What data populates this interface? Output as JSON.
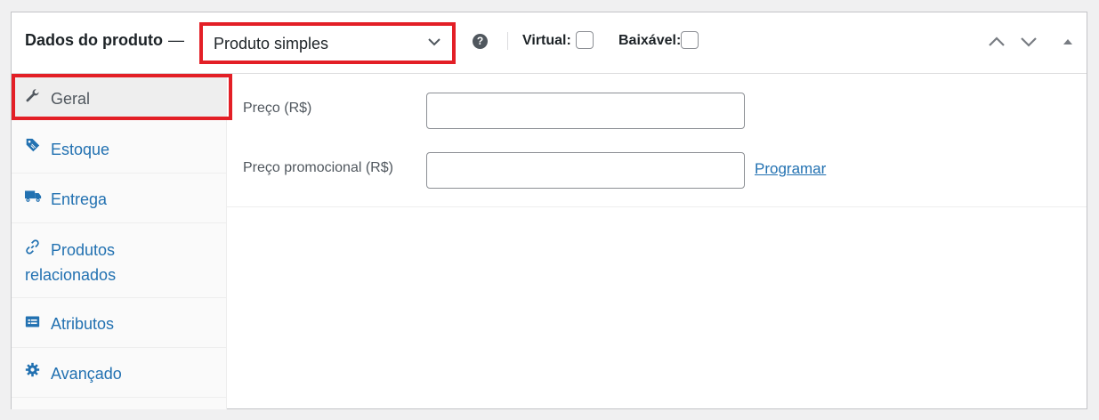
{
  "header": {
    "title": "Dados do produto",
    "title_separator": "—",
    "product_type": {
      "selected": "Produto simples"
    },
    "help_icon": "question-circle-icon",
    "virtual_label": "Virtual:",
    "virtual_checked": false,
    "downloadable_label": "Baixável:",
    "downloadable_checked": false
  },
  "sidebar": {
    "items": [
      {
        "label": "Geral",
        "icon": "wrench-icon",
        "active": true
      },
      {
        "label": "Estoque",
        "icon": "tag-icon",
        "active": false
      },
      {
        "label": "Entrega",
        "icon": "truck-icon",
        "active": false
      },
      {
        "label_line1": "Produtos",
        "label_line2": "relacionados",
        "icon": "link-icon",
        "active": false
      },
      {
        "label": "Atributos",
        "icon": "list-card-icon",
        "active": false
      },
      {
        "label": "Avançado",
        "icon": "gear-icon",
        "active": false
      }
    ]
  },
  "general": {
    "price_label": "Preço (R$)",
    "price_value": "",
    "sale_price_label": "Preço promocional (R$)",
    "sale_price_value": "",
    "schedule_link": "Programar"
  },
  "colors": {
    "accent": "#2271b1",
    "highlight": "#e31f26",
    "text": "#1d2327",
    "muted": "#50575e"
  }
}
